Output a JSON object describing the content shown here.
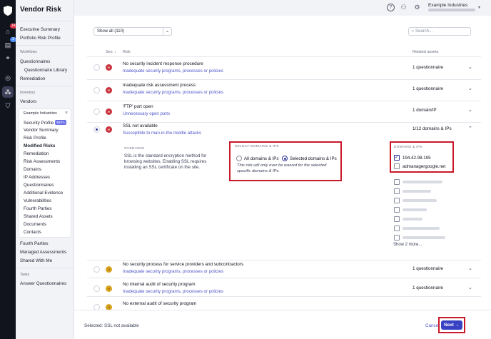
{
  "app": {
    "title": "Vendor Risk"
  },
  "rail": {
    "items": [
      {
        "icon": "home-icon",
        "badge": "14",
        "badge_color": "#e0344a"
      },
      {
        "icon": "document-icon",
        "badge": "3",
        "badge_color": "#4c8df6"
      },
      {
        "icon": "handshake-icon",
        "badge": ""
      },
      {
        "icon": "radar-icon",
        "badge": ""
      },
      {
        "icon": "vendors-icon",
        "badge": ""
      },
      {
        "icon": "shield-icon",
        "badge": ""
      }
    ]
  },
  "sidebar": {
    "executive_summary": "Executive Summary",
    "portfolio_risk_profile": "Portfolio Risk Profile",
    "workflows_label": "Workflows",
    "questionnaires": "Questionnaires",
    "questionnaire_library": "Questionnaire Library",
    "remediation": "Remediation",
    "inventory_label": "Inventory",
    "vendors": "Vendors",
    "vendor_name": "Example Industries",
    "vendor_items": [
      {
        "label": "Security Profile",
        "badge": "BETA"
      },
      {
        "label": "Vendor Summary"
      },
      {
        "label": "Risk Profile"
      },
      {
        "label": "Modified Risks"
      },
      {
        "label": "Remediation"
      },
      {
        "label": "Risk Assessments"
      },
      {
        "label": "Domains"
      },
      {
        "label": "IP Addresses"
      },
      {
        "label": "Questionnaires"
      },
      {
        "label": "Additional Evidence"
      },
      {
        "label": "Vulnerabilities"
      },
      {
        "label": "Fourth Parties"
      },
      {
        "label": "Shared Assets"
      },
      {
        "label": "Documents"
      },
      {
        "label": "Contacts"
      }
    ],
    "fourth_parties": "Fourth Parties",
    "managed_assessments": "Managed Assessments",
    "shared_with_me": "Shared With Me",
    "tasks_label": "Tasks",
    "answer_questionnaires": "Answer Questionnaires"
  },
  "topbar": {
    "org_name": "Example Industries"
  },
  "filter": {
    "selected": "Show all (110)",
    "search_placeholder": "Search..."
  },
  "table": {
    "headers": {
      "sev": "Sev.",
      "risk": "Risk",
      "assets": "Related assets"
    },
    "rows": [
      {
        "sev": "critical",
        "title": "No security incident response procedure",
        "sub": "Inadequate security programs, processes or policies",
        "assets": "1 questionnaire"
      },
      {
        "sev": "critical",
        "title": "Inadequate risk assessment process",
        "sub": "Inadequate security programs, processes or policies",
        "assets": "1 questionnaire"
      },
      {
        "sev": "critical",
        "title": "'FTP' port open",
        "sub": "Unnecessary open ports",
        "assets": "1 domain/IP"
      },
      {
        "sev": "critical",
        "title": "SSL not available",
        "sub": "Susceptible to man-in-the-middle attacks",
        "assets": "1/12 domains & IPs"
      },
      {
        "sev": "medium",
        "title": "No security process for service providers and subcontractors",
        "sub": "Inadequate security programs, processes or policies",
        "assets": "1 questionnaire"
      },
      {
        "sev": "medium",
        "title": "No internal audit of security program",
        "sub": "Inadequate security programs, processes or policies",
        "assets": "1 questionnaire"
      },
      {
        "sev": "medium",
        "title": "No external audit of security program",
        "sub": "",
        "assets": ""
      }
    ]
  },
  "expanded": {
    "overview_label": "OVERVIEW",
    "overview_text": "SSL is the standard encryption method for browsing websites. Enabling SSL requires installing an SSL certificate on the site.",
    "select_label": "SELECT DOMAINS & IPS",
    "option_all": "All domains & IPs",
    "option_selected": "Selected domains & IPs",
    "note": "This risk will only ever be waived for the selected specific domains & IPs.",
    "domains_label": "DOMAINS & IPS",
    "domains": [
      {
        "value": "194.42.98.195",
        "checked": true
      },
      {
        "value": "admanagergoogle.net",
        "checked": false
      }
    ],
    "show_more": "Show 2 more..."
  },
  "footer": {
    "selected_text": "Selected: SSL not available",
    "cancel": "Cancel",
    "next": "Next"
  },
  "colors": {
    "accent": "#3a42c4",
    "critical": "#c8303a",
    "medium": "#d9a320",
    "highlight": "#c8182a"
  }
}
